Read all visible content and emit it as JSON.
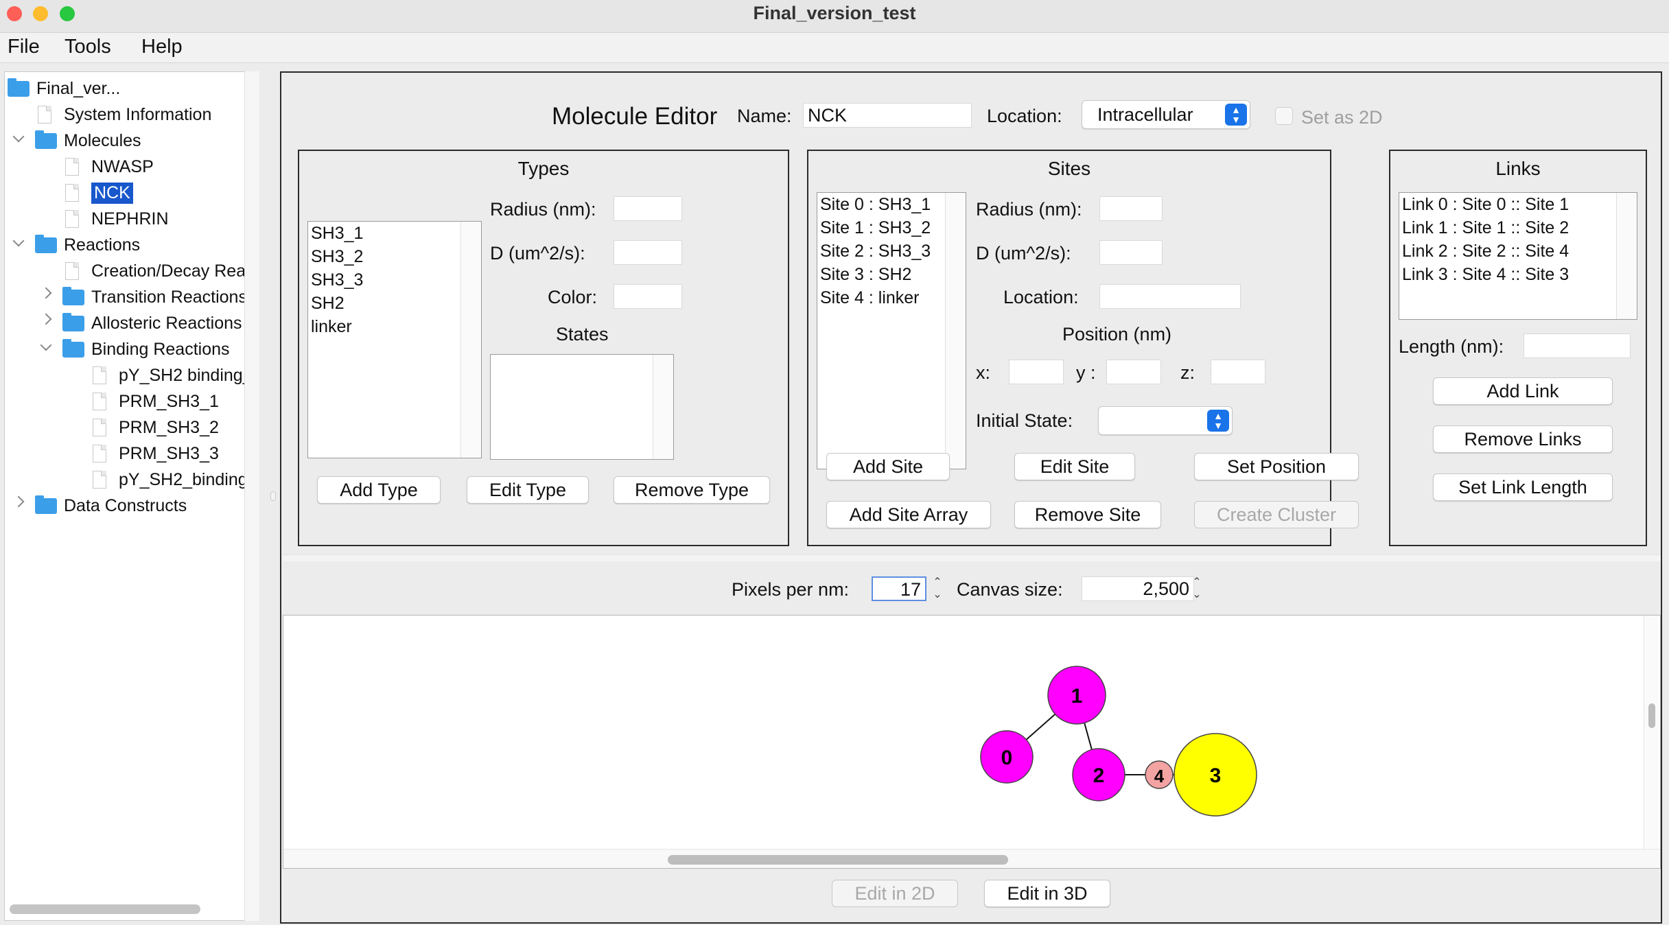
{
  "window": {
    "title": "Final_version_test"
  },
  "menu": [
    "File",
    "Tools",
    "Help"
  ],
  "tree": {
    "root": "Final_ver...",
    "items": [
      {
        "label": "System Information"
      },
      {
        "label": "Molecules"
      },
      {
        "label": "NWASP"
      },
      {
        "label": "NCK",
        "selected": true
      },
      {
        "label": "NEPHRIN"
      },
      {
        "label": "Reactions"
      },
      {
        "label": "Creation/Decay Rea"
      },
      {
        "label": "Transition Reactions"
      },
      {
        "label": "Allosteric Reactions"
      },
      {
        "label": "Binding Reactions"
      },
      {
        "label": "pY_SH2 binding_"
      },
      {
        "label": "PRM_SH3_1"
      },
      {
        "label": "PRM_SH3_2"
      },
      {
        "label": "PRM_SH3_3"
      },
      {
        "label": "pY_SH2_binding"
      },
      {
        "label": "Data Constructs"
      }
    ]
  },
  "editor": {
    "title": "Molecule Editor",
    "name_label": "Name:",
    "name_value": "NCK",
    "location_label": "Location:",
    "location_value": "Intracellular",
    "set2d_label": "Set as 2D"
  },
  "types": {
    "title": "Types",
    "items": [
      "SH3_1",
      "SH3_2",
      "SH3_3",
      "SH2",
      "linker"
    ],
    "radius_label": "Radius (nm):",
    "d_label": "D (um^2/s):",
    "color_label": "Color:",
    "states_label": "States",
    "buttons": [
      "Add Type",
      "Edit Type",
      "Remove Type"
    ]
  },
  "sites": {
    "title": "Sites",
    "items": [
      "Site 0 : SH3_1",
      "Site 1 : SH3_2",
      "Site 2 : SH3_3",
      "Site 3 : SH2",
      "Site 4 : linker"
    ],
    "radius_label": "Radius (nm):",
    "d_label": "D (um^2/s):",
    "location_label": "Location:",
    "position_label": "Position (nm)",
    "x_label": "x:",
    "y_label": "y :",
    "z_label": "z:",
    "initial_state_label": "Initial State:",
    "buttons": [
      "Add Site",
      "Edit Site",
      "Set Position",
      "Add Site Array",
      "Remove Site",
      "Create Cluster"
    ]
  },
  "links": {
    "title": "Links",
    "items": [
      "Link 0 : Site 0 :: Site 1",
      "Link 1 : Site 1 :: Site 2",
      "Link 2 : Site 2 :: Site 4",
      "Link 3 : Site 4 :: Site 3"
    ],
    "length_label": "Length (nm):",
    "buttons": [
      "Add Link",
      "Remove Links",
      "Set Link Length"
    ]
  },
  "canvas_controls": {
    "pixels_label": "Pixels per nm:",
    "pixels_value": "17",
    "canvas_size_label": "Canvas size:",
    "canvas_size_value": "2,500"
  },
  "molecule": {
    "nodes": [
      {
        "id": "0",
        "color": "#ff00ff"
      },
      {
        "id": "1",
        "color": "#ff00ff"
      },
      {
        "id": "2",
        "color": "#ff00ff"
      },
      {
        "id": "3",
        "color": "#ffff00"
      },
      {
        "id": "4",
        "color": "#f4a3a3"
      }
    ],
    "links": [
      [
        "0",
        "1"
      ],
      [
        "1",
        "2"
      ],
      [
        "2",
        "4"
      ],
      [
        "4",
        "3"
      ]
    ]
  },
  "bottom_buttons": {
    "edit2d": "Edit in 2D",
    "edit3d": "Edit in 3D"
  }
}
